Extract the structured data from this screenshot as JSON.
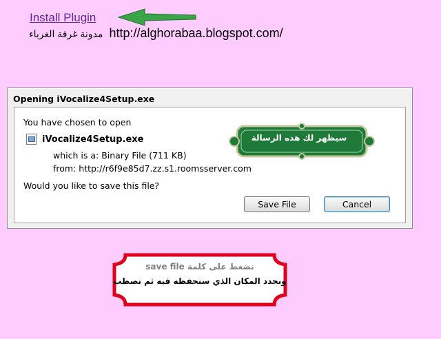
{
  "header": {
    "install_link": "Install Plugin",
    "blog_arabic": "مدونة غرفة الغرباء",
    "blog_url": "http://alghorabaa.blogspot.com/"
  },
  "dialog": {
    "title": "Opening iVocalize4Setup.exe",
    "chosen_text": "You have chosen to open",
    "filename": "iVocalize4Setup.exe",
    "which_is": "which is a:  Binary File (711  KB)",
    "from": "from:  http://r6f9e85d7.zz.s1.roomsserver.com",
    "question": "Would you like to save this file?",
    "save_label": "Save File",
    "cancel_label": "Cancel"
  },
  "annotations": {
    "green_label": "سيظهر لك هذه الرسالة",
    "red_line1": "نضغط على كلمة save file",
    "red_line2": "ونحدد المكان الذي سنحفظه فيه ثم نصطب"
  },
  "colors": {
    "page_bg": "#ffccff",
    "arrow_green": "#2e8b3a",
    "label_green": "#1f7a3a",
    "frame_red": "#e0001b"
  }
}
